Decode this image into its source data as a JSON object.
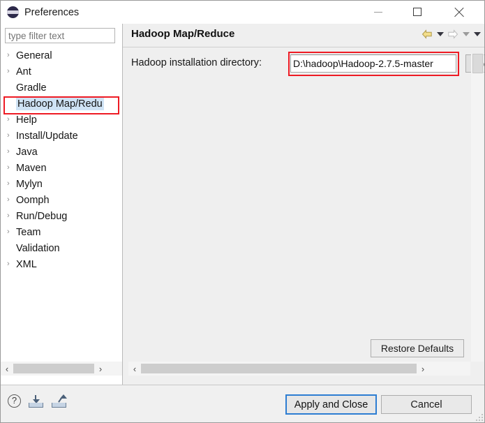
{
  "window": {
    "title": "Preferences",
    "icon": "eclipse-icon",
    "controls": {
      "minimize": "minimize-icon",
      "maximize": "maximize-icon",
      "close": "close-icon"
    }
  },
  "sidebar": {
    "filter": {
      "value": "",
      "placeholder": "type filter text"
    },
    "items": [
      {
        "label": "General",
        "expandable": true,
        "selected": false
      },
      {
        "label": "Ant",
        "expandable": true,
        "selected": false
      },
      {
        "label": "Gradle",
        "expandable": false,
        "selected": false
      },
      {
        "label": "Hadoop Map/Redu",
        "expandable": false,
        "selected": true
      },
      {
        "label": "Help",
        "expandable": true,
        "selected": false
      },
      {
        "label": "Install/Update",
        "expandable": true,
        "selected": false
      },
      {
        "label": "Java",
        "expandable": true,
        "selected": false
      },
      {
        "label": "Maven",
        "expandable": true,
        "selected": false
      },
      {
        "label": "Mylyn",
        "expandable": true,
        "selected": false
      },
      {
        "label": "Oomph",
        "expandable": true,
        "selected": false
      },
      {
        "label": "Run/Debug",
        "expandable": true,
        "selected": false
      },
      {
        "label": "Team",
        "expandable": true,
        "selected": false
      },
      {
        "label": "Validation",
        "expandable": false,
        "selected": false
      },
      {
        "label": "XML",
        "expandable": true,
        "selected": false
      }
    ],
    "expand_arrow": "›",
    "scroll": {
      "left_arrow": "‹",
      "right_arrow": "›"
    }
  },
  "page": {
    "title": "Hadoop Map/Reduce",
    "nav": {
      "back_icon": "back-arrow-icon",
      "forward_icon": "forward-arrow-icon"
    },
    "field": {
      "label": "Hadoop installation directory:",
      "value": "D:\\hadoop\\Hadoop-2.7.5-master",
      "placeholder": "",
      "browse_label": "Browse..."
    },
    "restore_defaults_label": "Restore Defaults",
    "scroll": {
      "left_arrow": "‹",
      "right_arrow": "›"
    }
  },
  "footer": {
    "help_label": "?",
    "import_icon": "import-icon",
    "export_icon": "export-icon",
    "apply_label": "Apply and Close",
    "cancel_label": "Cancel"
  },
  "annotations": {
    "accent_color": "#ee1b24",
    "selection_color": "#cfe3f5",
    "focus_color": "#2d7dd2"
  }
}
